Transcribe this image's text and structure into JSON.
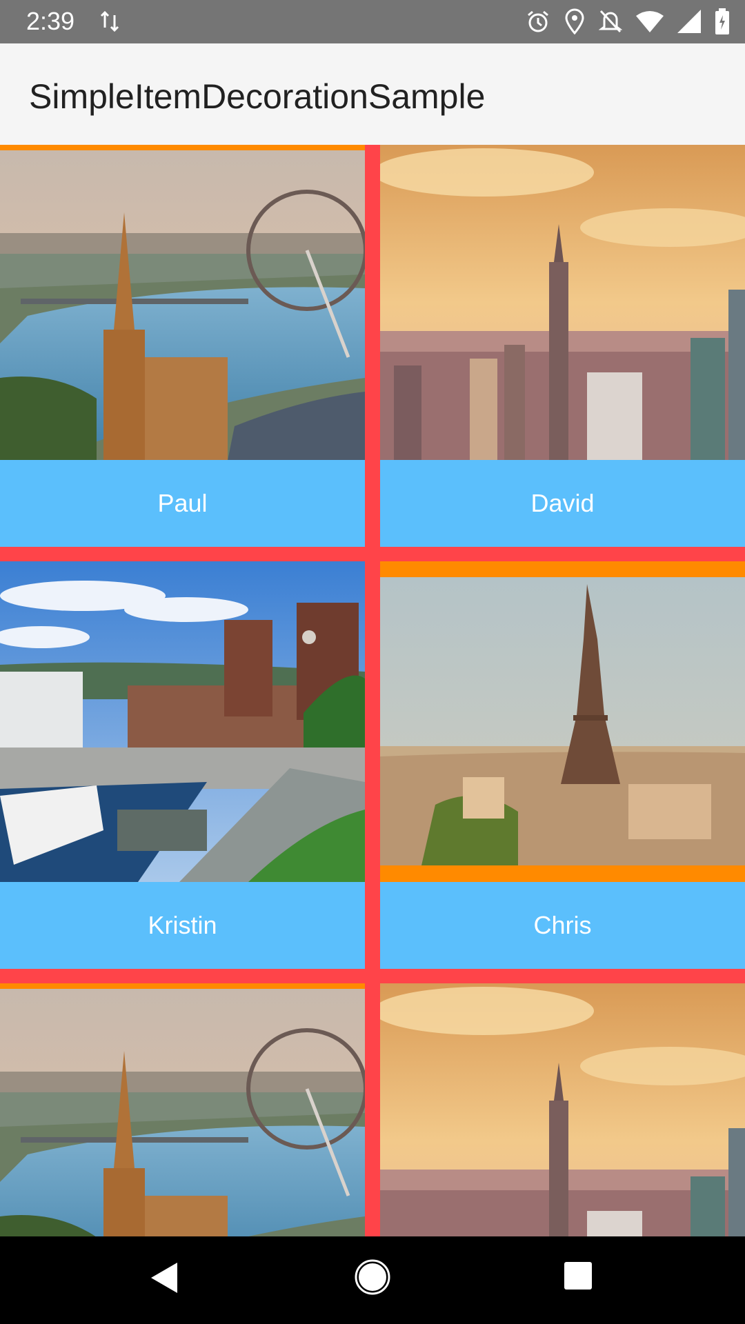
{
  "status_bar": {
    "time": "2:39",
    "icons": [
      "data-transfer-icon",
      "alarm-icon",
      "location-icon",
      "notifications-off-icon",
      "wifi-icon",
      "signal-icon",
      "battery-icon"
    ]
  },
  "app_bar": {
    "title": "SimpleItemDecorationSample"
  },
  "grid": {
    "items": [
      {
        "name": "Paul",
        "image": "london-skyline-photo"
      },
      {
        "name": "David",
        "image": "new-york-skyline-photo"
      },
      {
        "name": "Kristin",
        "image": "oslo-harbor-photo"
      },
      {
        "name": "Chris",
        "image": "paris-eiffel-tower-photo"
      },
      {
        "name": "",
        "image": "london-skyline-photo"
      },
      {
        "name": "",
        "image": "new-york-skyline-photo"
      }
    ]
  },
  "colors": {
    "divider": "#ff4449",
    "orange_decoration": "#ff8a00",
    "caption_bg": "#5bbffc",
    "status_bar": "#757575",
    "app_bar": "#f5f5f5"
  },
  "nav_bar": {
    "buttons": [
      "back-icon",
      "home-icon",
      "recents-icon"
    ]
  }
}
